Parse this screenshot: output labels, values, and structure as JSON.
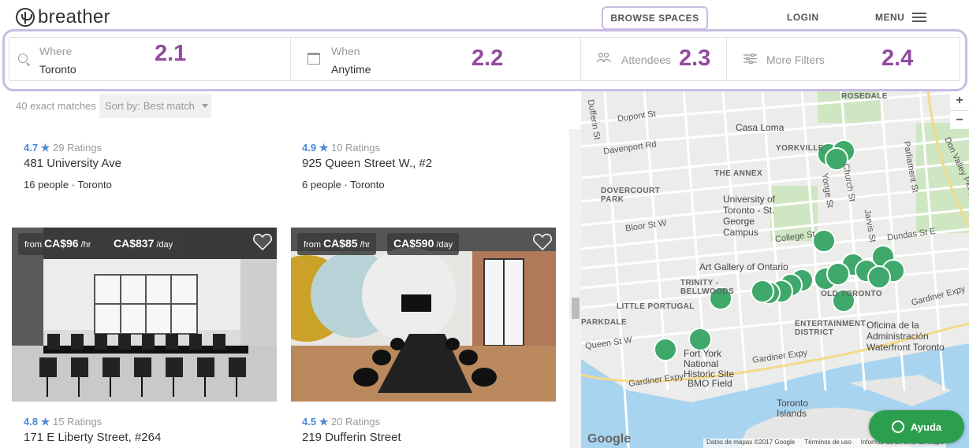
{
  "brand": {
    "name": "breather"
  },
  "nav": {
    "browse": "BROWSE SPACES",
    "login": "LOGIN",
    "menu": "MENU"
  },
  "search": {
    "where": {
      "label": "Where",
      "value": "Toronto",
      "tag": "2.1"
    },
    "when": {
      "label": "When",
      "value": "Anytime",
      "tag": "2.2"
    },
    "attendees": {
      "label": "Attendees",
      "tag": "2.3"
    },
    "more_filters": {
      "label": "More Filters",
      "tag": "2.4"
    }
  },
  "results": {
    "count": "40 exact matches",
    "sort_label": "Sort by:",
    "sort_value": "Best match"
  },
  "listings": [
    {
      "score": "4.7",
      "ratings": "29 Ratings",
      "address": "481 University Ave",
      "people": "16 people",
      "city": "Toronto"
    },
    {
      "score": "4.9",
      "ratings": "10 Ratings",
      "address": "925 Queen Street W., #2",
      "people": "6 people",
      "city": "Toronto"
    },
    {
      "score": "4.8",
      "ratings": "15 Ratings",
      "address": "171 E Liberty Street, #264",
      "from": "from",
      "hourly": "CA$96",
      "hourly_unit": "/hr",
      "daily": "CA$837",
      "daily_unit": "/day"
    },
    {
      "score": "4.5",
      "ratings": "20 Ratings",
      "address": "219 Dufferin Street",
      "from": "from",
      "hourly": "CA$85",
      "hourly_unit": "/hr",
      "daily": "CA$590",
      "daily_unit": "/day"
    }
  ],
  "map": {
    "labels": {
      "rosedale": "ROSEDALE",
      "casa_loma": "Casa Loma",
      "yorkville": "YORKVILLE",
      "annex": "THE ANNEX",
      "dovercourt": "DOVERCOURT PARK",
      "uoft": "University of Toronto - St. George Campus",
      "ago": "Art Gallery of Ontario",
      "trinity": "TRINITY - BELLWOODS",
      "little_portugal": "LITTLE PORTUGAL",
      "old_toronto": "OLD TORONTO",
      "entertainment": "ENTERTAINMENT DISTRICT",
      "oficina": "Oficina de la Administración Waterfront Toronto",
      "york_national": "Fort York National Historic Site",
      "bmo": "BMO Field",
      "toronto_islands": "Toronto Islands",
      "gardiner1": "Gardiner Expy",
      "gardiner2": "Gardiner Expy",
      "gardiner3": "Gardiner Expy",
      "queen_st": "Queen St W",
      "college": "College St",
      "bloor": "Bloor St W",
      "dupont": "Dupont St",
      "davenport": "Davenport Rd",
      "don_valley": "Don Valley Pkwy",
      "dufferin": "Dufferin St",
      "parkdale": "PARKDALE",
      "yonge": "Yonge St",
      "church": "Church St",
      "jarvis": "Jarvis St",
      "parliament": "Parliament St",
      "dundas": "Dundas St E"
    },
    "google": "Google",
    "attribution": [
      "Datos de mapas ©2017 Google",
      "Términos de uso",
      "Informar de un error de Mapa"
    ]
  },
  "help": {
    "label": "Ayuda"
  },
  "colors": {
    "accent": "#93499f",
    "pin": "#3fa86b",
    "score": "#4a8ad8",
    "help": "#2c9f4f"
  }
}
